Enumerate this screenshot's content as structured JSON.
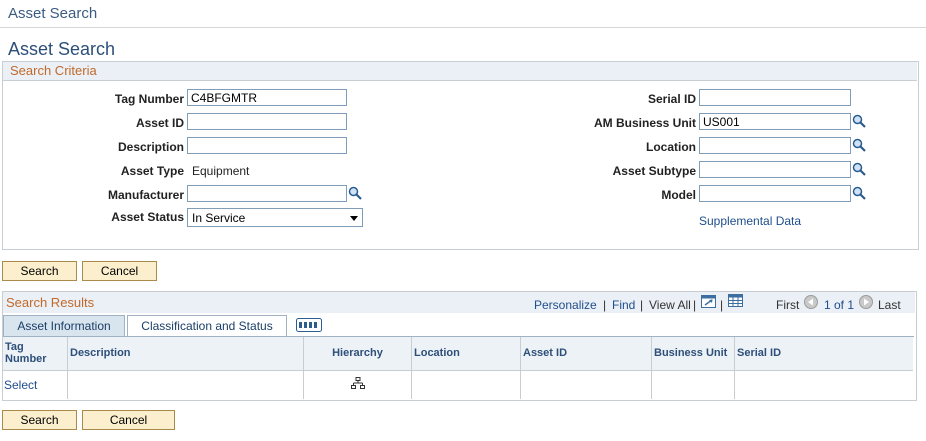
{
  "breadcrumb": "Asset Search",
  "page_title": "Asset Search",
  "criteria": {
    "header": "Search Criteria",
    "tag_number": {
      "label": "Tag Number",
      "value": "C4BFGMTR"
    },
    "asset_id": {
      "label": "Asset ID",
      "value": ""
    },
    "description": {
      "label": "Description",
      "value": ""
    },
    "asset_type": {
      "label": "Asset Type",
      "value": "Equipment"
    },
    "manufacturer": {
      "label": "Manufacturer",
      "value": ""
    },
    "asset_status": {
      "label": "Asset Status",
      "value": "In Service"
    },
    "serial_id": {
      "label": "Serial ID",
      "value": ""
    },
    "am_business_unit": {
      "label": "AM Business Unit",
      "value": "US001"
    },
    "location": {
      "label": "Location",
      "value": ""
    },
    "asset_subtype": {
      "label": "Asset Subtype",
      "value": ""
    },
    "model": {
      "label": "Model",
      "value": ""
    },
    "supplemental_link": "Supplemental Data"
  },
  "buttons": {
    "search": "Search",
    "cancel": "Cancel"
  },
  "results": {
    "header": "Search Results",
    "nav": {
      "personalize": "Personalize",
      "find": "Find",
      "view_all": "View All",
      "first": "First",
      "range": "1 of 1",
      "last": "Last",
      "sep": "|"
    },
    "tabs": [
      "Asset Information",
      "Classification and Status"
    ],
    "columns": [
      "Tag Number",
      "Description",
      "Hierarchy",
      "Location",
      "Asset ID",
      "Business Unit",
      "Serial ID"
    ],
    "rows": [
      {
        "tag_number": "Select",
        "description": "",
        "hierarchy_icon": "hierarchy-icon",
        "location": "",
        "asset_id": "",
        "business_unit": "",
        "serial_id": ""
      }
    ]
  },
  "icons": {
    "lookup": "magnifier-lookup-icon",
    "zoom": "zoom-grid-icon",
    "download": "download-spreadsheet-icon",
    "prev": "prev-arrow-icon",
    "next": "next-arrow-icon",
    "show_all_columns": "show-all-columns-icon"
  },
  "colors": {
    "link": "#1f4e8c",
    "section_header": "#c2692a",
    "button_bg": "#fcefcd",
    "title": "#2d4f7a"
  }
}
